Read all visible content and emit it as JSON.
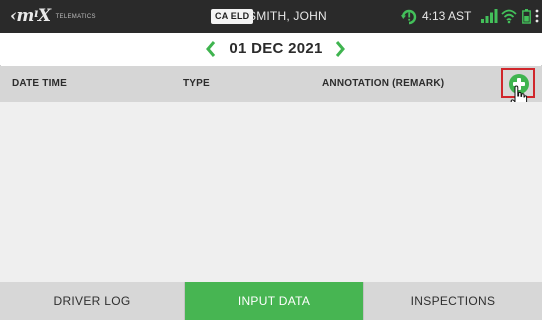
{
  "statusbar": {
    "logo_mark": "‹m‡X",
    "logo_sub": "TELEMATICS",
    "eld_badge": "CA ELD",
    "driver_name": "SMITH, JOHN",
    "time": "4:13 AST",
    "icons": [
      "sync-warning-icon",
      "signal-icon",
      "wifi-icon",
      "battery-icon",
      "kebab-menu-icon"
    ],
    "bg_color": "#2a2a2a"
  },
  "date_nav": {
    "date": "01 DEC 2021",
    "prev_icon": "chevron-left-icon",
    "next_icon": "chevron-right-icon",
    "accent_color": "#3fb44f"
  },
  "table": {
    "columns": [
      "DATE TIME",
      "TYPE",
      "ANNOTATION (REMARK)"
    ],
    "rows": [],
    "add_icon": "add-circle-icon"
  },
  "tabs": [
    {
      "label": "DRIVER LOG",
      "active": false
    },
    {
      "label": "INPUT DATA",
      "active": true
    },
    {
      "label": "INSPECTIONS",
      "active": false
    }
  ],
  "colors": {
    "active_tab": "#47b552",
    "highlight_box": "#d0262b"
  }
}
